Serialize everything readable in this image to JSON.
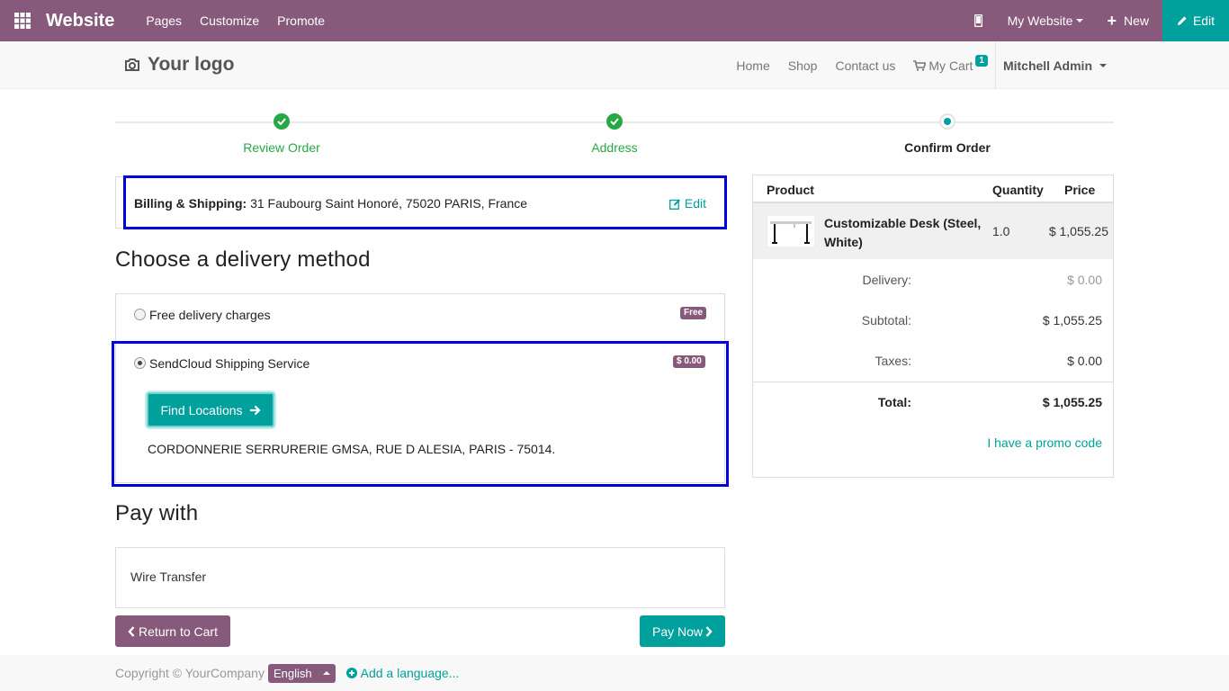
{
  "topbar": {
    "brand": "Website",
    "menu": [
      "Pages",
      "Customize",
      "Promote"
    ],
    "my_website": "My Website",
    "new_label": "New",
    "edit_label": "Edit"
  },
  "site": {
    "logo": "Your logo",
    "nav": {
      "home": "Home",
      "shop": "Shop",
      "contact": "Contact us",
      "cart": "My Cart",
      "cart_count": "1"
    },
    "user": "Mitchell Admin"
  },
  "wizard": {
    "steps": [
      {
        "label": "Review Order",
        "state": "done"
      },
      {
        "label": "Address",
        "state": "done"
      },
      {
        "label": "Confirm Order",
        "state": "current"
      }
    ]
  },
  "billing": {
    "label": "Billing & Shipping:",
    "address": " 31 Faubourg Saint Honoré, 75020 PARIS, France",
    "edit": "Edit"
  },
  "delivery": {
    "heading": "Choose a delivery method",
    "methods": [
      {
        "name": "Free delivery charges",
        "badge": "Free",
        "selected": false
      },
      {
        "name": "SendCloud Shipping Service",
        "badge": "$ 0.00",
        "selected": true
      }
    ],
    "find_locations": "Find Locations",
    "location": "CORDONNERIE SERRURERIE GMSA, RUE D ALESIA, PARIS - 75014."
  },
  "payment": {
    "heading": "Pay with",
    "method": "Wire Transfer",
    "return_label": "Return to Cart",
    "pay_label": "Pay Now"
  },
  "summary": {
    "headers": {
      "product": "Product",
      "quantity": "Quantity",
      "price": "Price"
    },
    "item": {
      "name": "Customizable Desk (Steel, White)",
      "qty": "1.0",
      "price": "$ 1,055.25"
    },
    "delivery_label": "Delivery:",
    "delivery_value": "$ 0.00",
    "subtotal_label": "Subtotal:",
    "subtotal_value": "$ 1,055.25",
    "taxes_label": "Taxes:",
    "taxes_value": "$ 0.00",
    "total_label": "Total:",
    "total_value": "$ 1,055.25",
    "promo": "I have a promo code"
  },
  "footer": {
    "copyright": "Copyright © YourCompany",
    "language": "English",
    "add_language": "Add a language..."
  },
  "colors": {
    "primary": "#875a7b",
    "accent": "#00a09d",
    "success": "#28a745",
    "highlight": "#0000dd"
  }
}
